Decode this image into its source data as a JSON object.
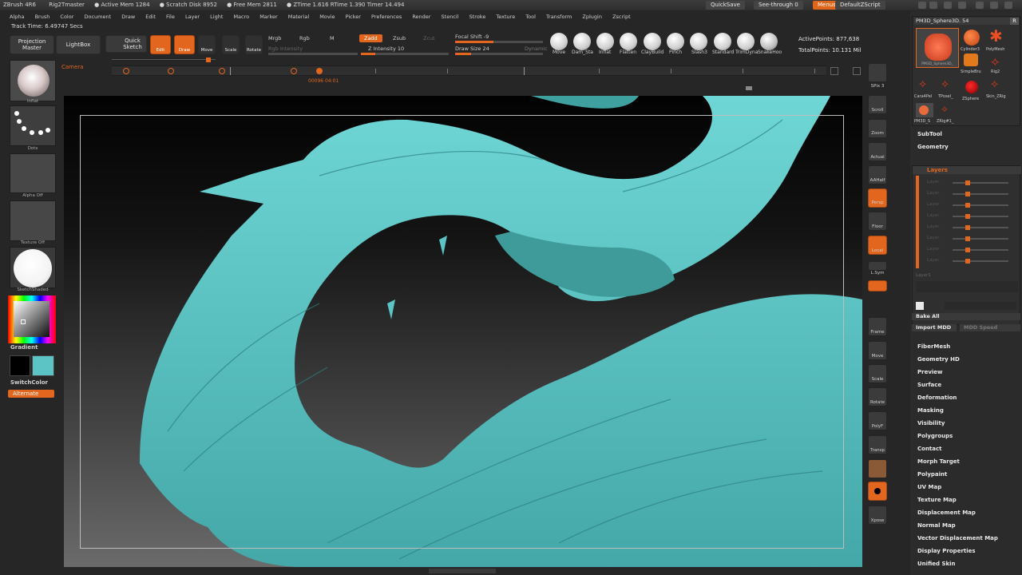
{
  "titlebar": {
    "app": "ZBrush 4R6",
    "document": "Rig2Tmaster",
    "stats": [
      "● Active Mem 1284",
      "● Scratch Disk 8952",
      "● Free Mem 2811",
      "● ZTime 1.616 RTime 1.390 Timer 14.494"
    ],
    "quicksave": "QuickSave",
    "see_through": "See-through 0",
    "menus": "Menus",
    "default_zscript": "DefaultZScript"
  },
  "menubar": [
    "Alpha",
    "Brush",
    "Color",
    "Document",
    "Draw",
    "Edit",
    "File",
    "Layer",
    "Light",
    "Macro",
    "Marker",
    "Material",
    "Movie",
    "Picker",
    "Preferences",
    "Render",
    "Stencil",
    "Stroke",
    "Texture",
    "Tool",
    "Transform",
    "Zplugin",
    "Zscript"
  ],
  "track_time": "Track Time: 6.49747 Secs",
  "shelf": {
    "projection_master": "Projection Master",
    "lightbox": "LightBox",
    "quick_sketch": "Quick Sketch",
    "edit": "Edit",
    "draw": "Draw",
    "move": "Move",
    "scale": "Scale",
    "rotate": "Rotate",
    "mrgb": "Mrgb",
    "rgb": "Rgb",
    "m": "M",
    "rgb_intensity": "Rgb Intensity",
    "zadd": "Zadd",
    "zsub": "Zsub",
    "zcut": "Zcut",
    "z_intensity": "Z Intensity 10",
    "focal_shift": "Focal Shift -9",
    "draw_size": "Draw Size 24",
    "dynamic": "Dynamic",
    "active_points": "ActivePoints: 877,638",
    "total_points": "TotalPoints: 10.131 Mil"
  },
  "brushes": [
    "Move",
    "Dam_Sta",
    "Inflat",
    "Flatten",
    "ClayBuild",
    "Pinch",
    "Slash3",
    "Standard",
    "TrimDyna",
    "SnakeHoo"
  ],
  "camera_label": "Camera",
  "timeline_readout": "00096 04:01",
  "left_shelf": {
    "inflat": "Inflat",
    "dots": "Dots",
    "alpha_off": "Alpha Off",
    "texture_off": "Texture Off",
    "sketch_shaded": "SketchShaded",
    "gradient": "Gradient",
    "switch_color": "SwitchColor",
    "alternate": "Alternate"
  },
  "right_tools": [
    "SPix 3",
    "Scroll",
    "Zoom",
    "Actual",
    "AAHalf",
    "Persp",
    "Floor",
    "Local",
    "L.Sym",
    "Frame",
    "Move",
    "Scale",
    "Rotate",
    "PolyF",
    "Transp",
    "Ghost",
    "Solo",
    "Xpose"
  ],
  "tool_panel": {
    "current_tool": "PM3D_Sphere3D. 54",
    "r_label": "R",
    "thumbs": [
      "PM3D_Sphere3D_",
      "Cylinder3",
      "PolyMesh",
      "SimpleBru",
      "Rig2",
      "Cara4Pel",
      "TPoseI_",
      "ZSphere",
      "Skin_ZRig",
      "PM3D_S",
      "ZRig#1_"
    ],
    "subtool": "SubTool",
    "geometry": "Geometry",
    "layers": "Layers",
    "layer_names": [
      "Layer",
      "Layer",
      "Layer",
      "Layer",
      "Layer",
      "Layer",
      "Layer",
      "Layer"
    ],
    "layer_footer": "Layer1",
    "bake_all": "Bake All",
    "import_mdd": "Import MDD",
    "mdd_speed": "MDD Speed",
    "menus": [
      "FiberMesh",
      "Geometry HD",
      "Preview",
      "Surface",
      "Deformation",
      "Masking",
      "Visibility",
      "Polygroups",
      "Contact",
      "Morph Target",
      "Polypaint",
      "UV Map",
      "Texture Map",
      "Displacement Map",
      "Normal Map",
      "Vector Displacement Map",
      "Display Properties",
      "Unified Skin"
    ]
  },
  "colors": {
    "accent": "#e2661e",
    "model": "#5cc4c4",
    "background_top": "#020202",
    "background_bottom": "#6b6b6b"
  }
}
